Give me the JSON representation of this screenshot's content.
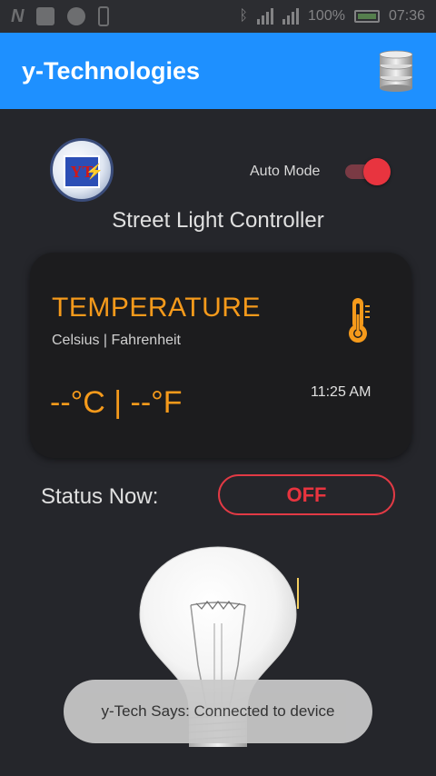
{
  "status_bar": {
    "notification_icons": [
      "n-icon",
      "image-icon",
      "circle-icon",
      "phone-icon"
    ],
    "battery_text": "100%",
    "time": "07:36"
  },
  "app_bar": {
    "title": "y-Technologies",
    "database_icon": "database-icon",
    "background_color": "#1e90ff"
  },
  "header": {
    "logo_text": "YT",
    "auto_mode_label": "Auto Mode",
    "auto_mode_on": true,
    "subtitle": "Street Light Controller"
  },
  "temperature_card": {
    "title": "TEMPERATURE",
    "units": "Celsius | Fahrenheit",
    "value": "--°C | --°F",
    "time": "11:25 AM",
    "icon": "thermometer-icon",
    "accent_color": "#f59a1b"
  },
  "status": {
    "label": "Status Now:",
    "button_text": "OFF",
    "color": "#e8343f"
  },
  "bulb": {
    "icon": "light-bulb-icon",
    "state": "off"
  },
  "toast": {
    "message": "y-Tech Says: Connected to device"
  }
}
